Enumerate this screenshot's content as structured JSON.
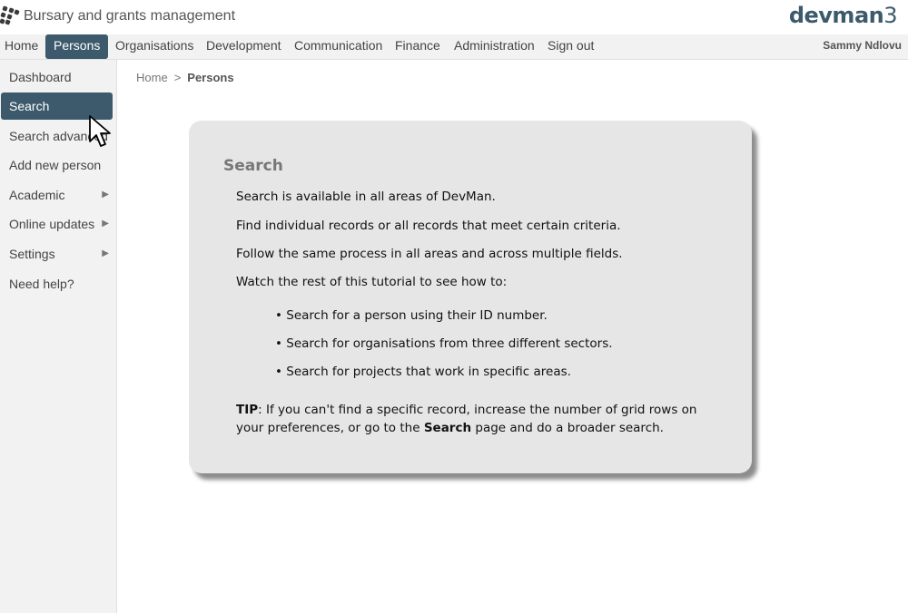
{
  "header": {
    "app_title": "Bursary and grants management",
    "brand": "devman",
    "brand_suffix": "3"
  },
  "topnav": {
    "items": [
      "Home",
      "Persons",
      "Organisations",
      "Development",
      "Communication",
      "Finance",
      "Administration",
      "Sign out"
    ],
    "active": "Persons",
    "user": "Sammy Ndlovu"
  },
  "sidebar": {
    "items": [
      {
        "label": "Dashboard"
      },
      {
        "label": "Search"
      },
      {
        "label": "Search advanced"
      },
      {
        "label": "Add new person"
      },
      {
        "label": "Academic",
        "arrow": "▶"
      },
      {
        "label": "Online updates",
        "arrow": "▶"
      },
      {
        "label": "Settings",
        "arrow": "▶"
      },
      {
        "label": "Need help?"
      }
    ],
    "active": "Search"
  },
  "breadcrumb": {
    "home": "Home",
    "separator": ">",
    "current": "Persons"
  },
  "card": {
    "title": "Search",
    "paragraphs": [
      "Search is available in all areas of DevMan.",
      "Find individual records or all records that meet certain criteria.",
      "Follow the same process in all areas and across multiple fields.",
      "Watch the rest of this tutorial to see how to:"
    ],
    "bullets": [
      "• Search for a person using their ID number.",
      "• Search for organisations from three different sectors.",
      "• Search for projects that work in specific areas."
    ],
    "tip_label": "TIP",
    "tip_text_1": ": If you can't find a specific record, increase the number of grid rows on your preferences, or go to the ",
    "tip_bold": "Search",
    "tip_text_2": " page and do a broader search."
  },
  "colors": {
    "accent": "#3d5a6c",
    "nav_bg": "#f2f2f2",
    "card_bg": "#e6e6e6"
  },
  "icons": {
    "logo": "devman-logo-icon",
    "cursor": "mouse-pointer-icon"
  }
}
